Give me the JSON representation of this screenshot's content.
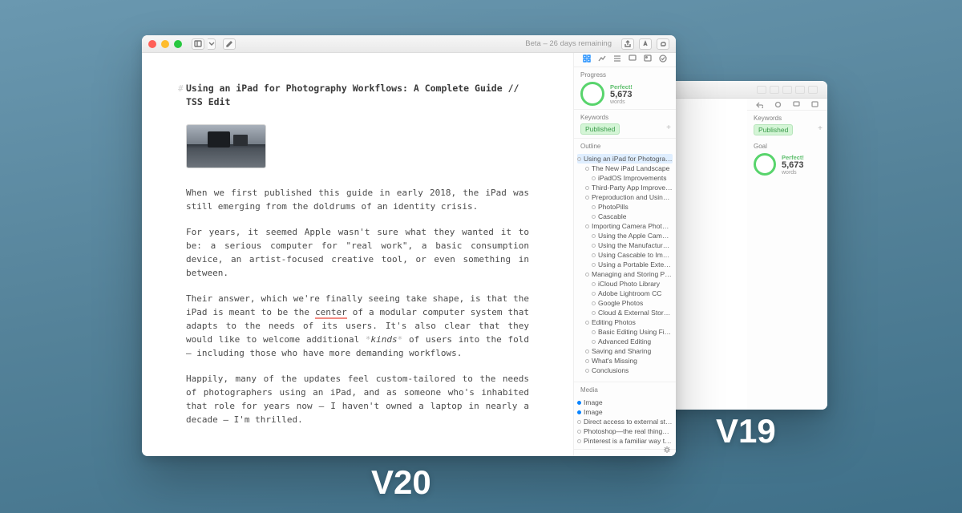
{
  "labels": {
    "v20": "V20",
    "v19": "V19"
  },
  "toolbar": {
    "beta": "Beta – 26 days remaining"
  },
  "doc": {
    "hash": "#",
    "title": "Using an iPad for Photography Workflows: A Complete Guide // TSS Edit",
    "p1": "When we first published this guide in early 2018, the iPad was still emerging from the doldrums of an identity crisis.",
    "p2": "For years, it seemed Apple wasn't sure what they wanted it to be: a serious computer for \"real work\", a basic consumption device, an artist-focused creative tool, or even something in between.",
    "p3a": "Their answer, which we're finally seeing take shape, is that the iPad is meant to be the ",
    "p3b": "center",
    "p3c": " of a modular computer system that adapts to the needs of its users. It's also clear that they would like to welcome additional ",
    "p3d_l": "*",
    "p3d": "kinds",
    "p3d_r": "*",
    "p3e": " of users into the fold — including those who have more demanding workflows.",
    "p4": "Happily, many of the updates feel custom-tailored to the needs of photographers using an iPad, and as someone who's inhabited that role for years now — I haven't owned a laptop in nearly a decade — I'm thrilled."
  },
  "sidebar": {
    "progress_label": "Progress",
    "perfect": "Perfect!",
    "count": "5,673",
    "words": "words",
    "keywords_label": "Keywords",
    "tag": "Published",
    "outline_label": "Outline",
    "media_label": "Media",
    "outline": [
      {
        "t": "Using an iPad for Photography Wor…",
        "d": 0,
        "sel": true
      },
      {
        "t": "The New iPad Landscape",
        "d": 1
      },
      {
        "t": "iPadOS Improvements",
        "d": 2
      },
      {
        "t": "Third-Party App Improvements",
        "d": 1
      },
      {
        "t": "Preproduction and Using an iPad…",
        "d": 1
      },
      {
        "t": "PhotoPills",
        "d": 2
      },
      {
        "t": "Cascable",
        "d": 2
      },
      {
        "t": "Importing Camera Photos on an i…",
        "d": 1
      },
      {
        "t": "Using the Apple Camera Adapt…",
        "d": 2
      },
      {
        "t": "Using the Manufacturer-Specifi…",
        "d": 2
      },
      {
        "t": "Using Cascable to Import Wirel…",
        "d": 2
      },
      {
        "t": "Using a Portable External Drive",
        "d": 2
      },
      {
        "t": "Managing and Storing Photos",
        "d": 1
      },
      {
        "t": "iCloud Photo Library",
        "d": 2
      },
      {
        "t": "Adobe Lightroom CC",
        "d": 2
      },
      {
        "t": "Google Photos",
        "d": 2
      },
      {
        "t": "Cloud & External Storage",
        "d": 2
      },
      {
        "t": "Editing Photos",
        "d": 1
      },
      {
        "t": "Basic Editing Using Filter Apps",
        "d": 2
      },
      {
        "t": "Advanced Editing",
        "d": 2
      },
      {
        "t": "Saving and Sharing",
        "d": 1
      },
      {
        "t": "What's Missing",
        "d": 1
      },
      {
        "t": "Conclusions",
        "d": 1
      }
    ],
    "media": [
      {
        "t": "Image",
        "blue": true
      },
      {
        "t": "Image",
        "blue": true
      },
      {
        "t": "Direct access to external storage is…"
      },
      {
        "t": "Photoshop—the real thing—storme…"
      },
      {
        "t": "Pinterest is a familiar way to create…"
      }
    ]
  },
  "v19": {
    "keywords_label": "Keywords",
    "tag": "Published",
    "goal_label": "Goal",
    "perfect": "Perfect!",
    "count": "5,673",
    "words": "words"
  }
}
